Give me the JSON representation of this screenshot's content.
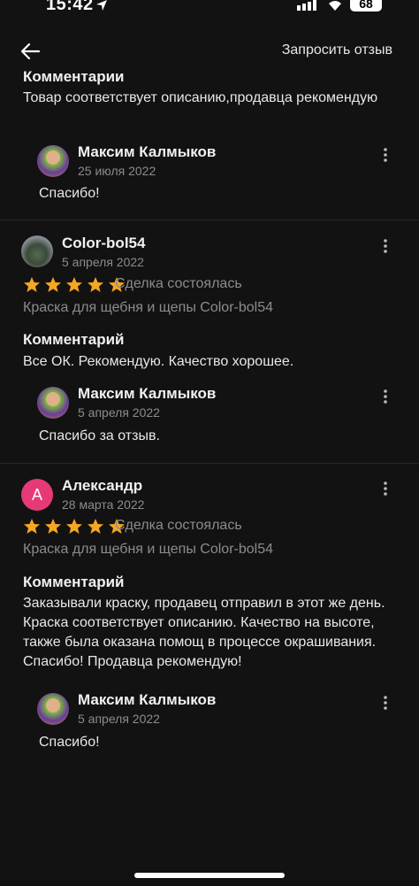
{
  "status": {
    "time": "15:42",
    "battery": "68"
  },
  "appbar": {
    "action": "Запросить отзыв"
  },
  "top_section": {
    "heading": "Комментарии",
    "comment": "Товар соответствует описанию,продавца рекомендую",
    "reply": {
      "name": "Максим Калмыков",
      "date": "25 июля 2022",
      "text": "Спасибо!"
    }
  },
  "reviews": [
    {
      "name": "Color-bol54",
      "date": "5 апреля 2022",
      "rating": 5,
      "status": "Сделка состоялась",
      "product": "Краска для щебня и щепы Color-bol54",
      "comment_heading": "Комментарий",
      "comment": "Все ОК. Рекомендую. Качество хорошее.",
      "reply": {
        "name": "Максим Калмыков",
        "date": "5 апреля 2022",
        "text": "Спасибо за отзыв."
      }
    },
    {
      "name": "Александр",
      "avatar_letter": "А",
      "date": "28 марта 2022",
      "rating": 5,
      "status": "Сделка состоялась",
      "product": "Краска для щебня и щепы Color-bol54",
      "comment_heading": "Комментарий",
      "comment": "Заказывали краску, продавец отправил в этот же день. Краска соответствует описанию. Качество на высоте, также была оказана помощ в процессе окрашивания. Спасибо! Продавца рекомендую!",
      "reply": {
        "name": "Максим Калмыков",
        "date": "5 апреля 2022",
        "text": "Спасибо!"
      }
    }
  ],
  "colors": {
    "star": "#f5a623",
    "background": "#121212",
    "avatar_letter_bg": "#e63a78"
  },
  "icons": {
    "back": "arrow-left-icon",
    "more": "more-vertical-icon",
    "star": "star-icon"
  }
}
